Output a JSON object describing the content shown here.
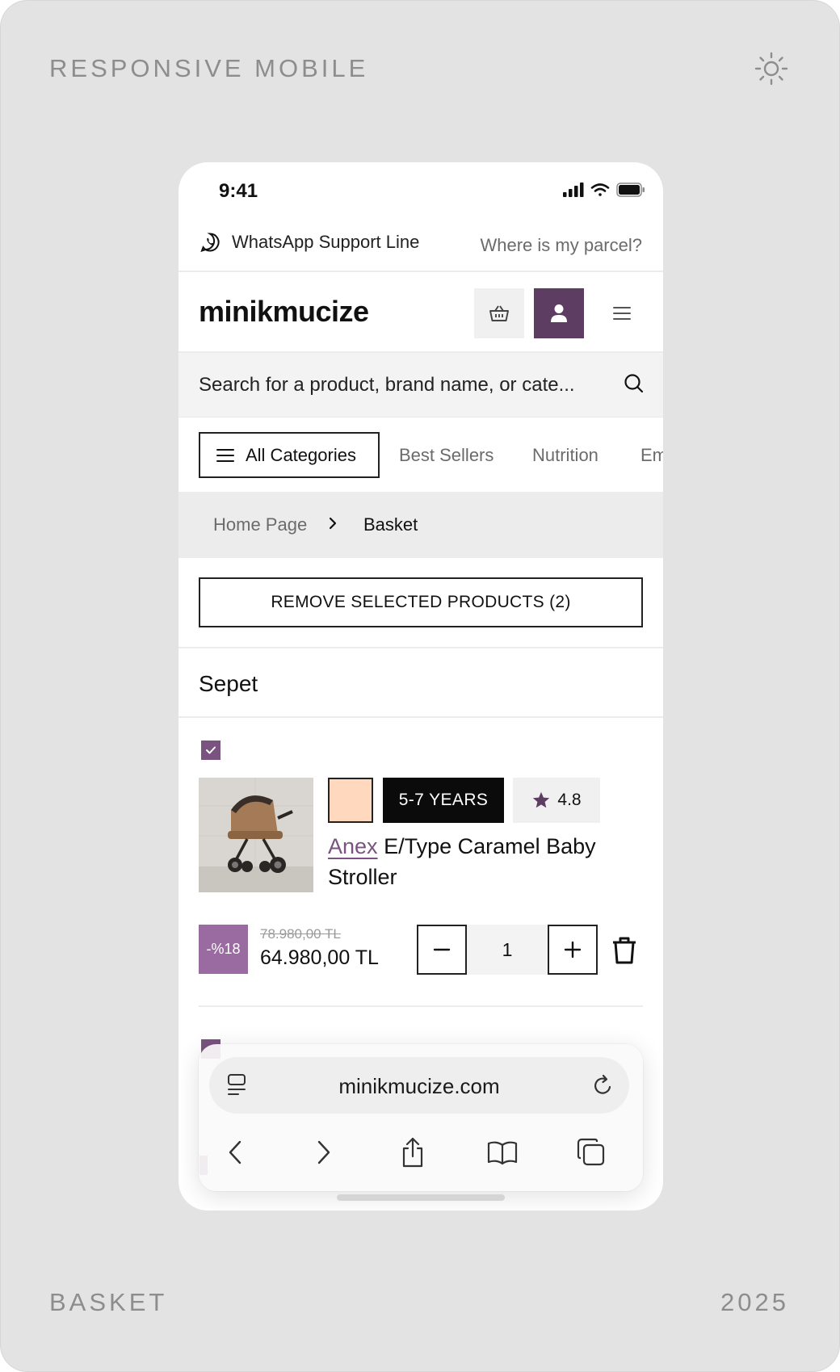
{
  "frame": {
    "top_left_label": "RESPONSIVE MOBILE",
    "bottom_left_label": "BASKET",
    "bottom_right_label": "2025",
    "theme_icon": "sun-icon"
  },
  "status_bar": {
    "time": "9:41",
    "icons": [
      "signal-icon",
      "wifi-icon",
      "battery-icon"
    ]
  },
  "support_bar": {
    "whatsapp_label": "WhatsApp Support Line",
    "parcel_link": "Where is my parcel?"
  },
  "header": {
    "logo": "minikmucize",
    "icons": [
      "basket-icon",
      "user-icon",
      "hamburger-icon"
    ],
    "accent_color": "#5e3d63"
  },
  "search": {
    "placeholder": "Search for a product, brand name, or cate..."
  },
  "categories": {
    "all_label": "All Categories",
    "items": [
      "Best Sellers",
      "Nutrition",
      "Em"
    ]
  },
  "breadcrumb": {
    "home": "Home Page",
    "current": "Basket"
  },
  "basket": {
    "remove_selected_label": "REMOVE SELECTED PRODUCTS (2)",
    "section_title": "Sepet",
    "items": [
      {
        "selected": true,
        "color_swatch": "#ffd8bd",
        "age_label": "5-7 YEARS",
        "rating": "4.8",
        "brand": "Anex",
        "name": "E/Type Caramel Baby Stroller",
        "discount": "-%18",
        "old_price": "78.980,00 TL",
        "price": "64.980,00 TL",
        "quantity": "1"
      }
    ]
  },
  "browser": {
    "url": "minikmucize.com",
    "nav_icons": [
      "back-icon",
      "forward-icon",
      "share-icon",
      "bookmarks-icon",
      "tabs-icon"
    ]
  }
}
